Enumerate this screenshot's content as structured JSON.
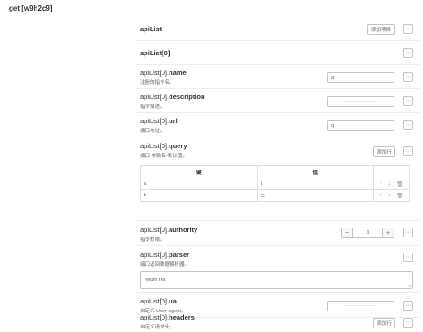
{
  "title": "get [w9h2c9]",
  "rows": {
    "apiList": {
      "label": "apiList",
      "add_label": "添加项目"
    },
    "item": {
      "label": "apiList[0]"
    },
    "name": {
      "prefix": "apiList[0].",
      "key": "name",
      "desc": "注册的指令名。",
      "value": "a"
    },
    "description": {
      "prefix": "apiList[0].",
      "key": "description",
      "desc": "指令描述。",
      "placeholder": "———————"
    },
    "url": {
      "prefix": "apiList[0].",
      "key": "url",
      "desc": "接口地址。",
      "value": "q"
    },
    "query": {
      "prefix": "apiList[0].",
      "key": "query",
      "desc": "接口 参数名-默认值。",
      "add_label": "添加行",
      "columns": [
        "键",
        "值"
      ],
      "rows": [
        {
          "key": "a",
          "value": "1"
        },
        {
          "key": "b",
          "value": "二"
        }
      ]
    },
    "authority": {
      "prefix": "apiList[0].",
      "key": "authority",
      "desc": "指令权限。",
      "value": "1"
    },
    "parser": {
      "prefix": "apiList[0].",
      "key": "parser",
      "desc": "接口返回数据解析器。",
      "value": "return res"
    },
    "ua": {
      "prefix": "apiList[0].",
      "key": "ua",
      "desc": "自定义 User-Agent。",
      "placeholder": "———————"
    },
    "headers": {
      "prefix": "apiList[0].",
      "key": "headers",
      "desc": "自定义请求头。",
      "add_label": "添加行"
    }
  },
  "icons": {
    "more": "⋯",
    "up": "↑",
    "down": "↓",
    "delete": "🗑",
    "minus": "−",
    "plus": "+"
  }
}
